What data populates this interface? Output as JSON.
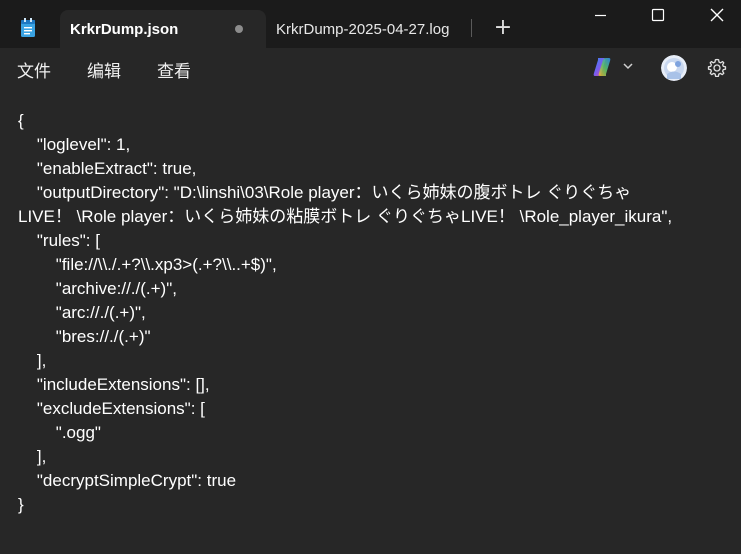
{
  "tabs": [
    {
      "label": "KrkrDump.json",
      "active": true,
      "unsaved": true
    },
    {
      "label": "KrkrDump-2025-04-27.log",
      "active": false
    }
  ],
  "new_tab_label": "+",
  "menu": {
    "file": "文件",
    "edit": "编辑",
    "view": "查看"
  },
  "icons": {
    "app": "notepad-icon",
    "copilot": "copilot-icon",
    "chevron": "chevron-down-icon",
    "avatar": "user-avatar",
    "settings": "gear-icon",
    "minimize": "minimize-icon",
    "maximize": "maximize-icon",
    "close": "close-icon"
  },
  "colors": {
    "titlebar": "#1b1b1b",
    "editor_bg": "#272727",
    "text": "#ffffff"
  },
  "document": {
    "lines": [
      "{",
      "    \"loglevel\": 1,",
      "    \"enableExtract\": true,",
      "    \"outputDirectory\": \"D:\\linshi\\03\\Role player：いくら姉妹の腹ボトレ ぐりぐちゃ",
      "LIVE！ \\Role player：いくら姉妹の粘膜ボトレ ぐりぐちゃLIVE！ \\Role_player_ikura\",",
      "    \"rules\": [",
      "        \"file://\\\\./.+?\\\\.xp3>(.+?\\\\..+$)\",",
      "        \"archive://./(.+)\",",
      "        \"arc://./(.+)\",",
      "        \"bres://./(.+)\"",
      "    ],",
      "    \"includeExtensions\": [],",
      "    \"excludeExtensions\": [",
      "        \".ogg\"",
      "    ],",
      "    \"decryptSimpleCrypt\": true",
      "}"
    ]
  }
}
